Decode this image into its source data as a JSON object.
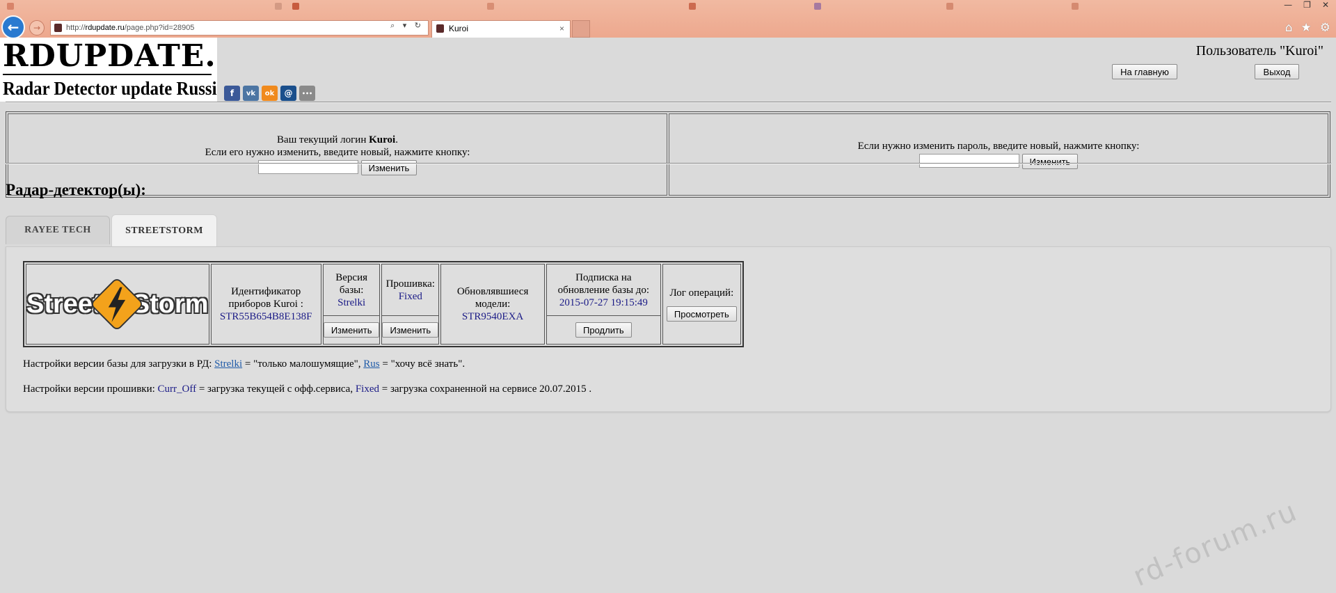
{
  "browser": {
    "url_prefix": "http://",
    "url_domain": "rdupdate.ru",
    "url_path": "/page.php?id=28905",
    "active_tab_title": "Kuroi",
    "tab_close": "×",
    "back_glyph": "←",
    "forward_glyph": "→",
    "address_icons": "⌕ ▾ ↻",
    "window_controls": [
      "—",
      "❐",
      "✕"
    ],
    "toolbar_icons": [
      "⌂",
      "★",
      "⚙"
    ],
    "accent": "#2a7ad0"
  },
  "header": {
    "logo_title": "RDUPDATE.RU",
    "logo_subtitle": "Radar Detector update Russian site",
    "user_title": "Пользователь \"Kuroi\"",
    "home_button": "На главную",
    "exit_button": "Выход",
    "share_icons": [
      {
        "name": "facebook",
        "glyph": "f",
        "color": "#3b5998"
      },
      {
        "name": "vkontakte",
        "glyph": "vk",
        "color": "#4c75a3"
      },
      {
        "name": "odnoklassniki",
        "glyph": "ok",
        "color": "#f08a1d"
      },
      {
        "name": "mail",
        "glyph": "@",
        "color": "#1a4f8c"
      },
      {
        "name": "more",
        "glyph": "•••",
        "color": "#8a8a8a"
      }
    ]
  },
  "login_box": {
    "current_login_prefix": "Ваш текущий логин ",
    "current_login": "Kuroi",
    "current_login_suffix": ".",
    "change_login_hint": "Если его нужно изменить, введите новый, нажмите кнопку:",
    "change_login_value": "",
    "change_login_button": "Изменить",
    "change_password_hint": "Если нужно изменить пароль, введите новый, нажмите кнопку:",
    "change_password_value": "",
    "change_password_button": "Изменить"
  },
  "section_title": "Радар-детектор(ы):",
  "tabs": [
    {
      "label": "RAYEE TECH",
      "active": false
    },
    {
      "label": "STREETSTORM",
      "active": true
    }
  ],
  "device": {
    "logo_left": "Street",
    "logo_right": "Storm",
    "identifier_label": "Идентификатор приборов Kuroi :",
    "identifier_value": "STR55B654B8E138F",
    "db_version_label": "Версия базы:",
    "db_version_value": "Strelki",
    "db_version_button": "Изменить",
    "firmware_label": "Прошивка:",
    "firmware_value": "Fixed",
    "firmware_button": "Изменить",
    "updated_models_label": "Обновлявшиеся модели:",
    "updated_models_value": "STR9540EXA",
    "subscription_label": "Подписка на обновление базы до:",
    "subscription_value": "2015-07-27 19:15:49",
    "subscription_button": "Продлить",
    "log_label": "Лог операций:",
    "log_button": "Просмотреть"
  },
  "notes": {
    "db_prefix": "Настройки версии базы для загрузки в РД: ",
    "db_link1": "Strelki",
    "db_mid": " = \"только малошумящие\", ",
    "db_link2": "Rus",
    "db_suffix": " = \"хочу всё знать\".",
    "fw_prefix": "Настройки версии прошивки: ",
    "fw_opt1": "Curr_Off",
    "fw_mid": " = загрузка текущей с офф.сервиса, ",
    "fw_opt2": "Fixed",
    "fw_suffix": " = загрузка сохраненной на сервисе 20.07.2015 ."
  },
  "watermark": "rd-forum.ru"
}
